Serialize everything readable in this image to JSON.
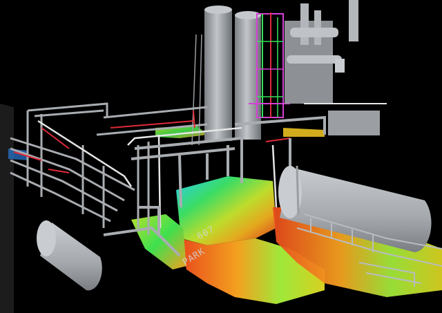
{
  "viewport": {
    "background": "#000000",
    "labels": {
      "unit_number": "607",
      "unit_number_small": "607",
      "area_name": "PARK"
    },
    "colors": {
      "steel": "#a9adb1",
      "steel_dark": "#6d7276",
      "pipe_red": "#e02a3a",
      "pipe_green": "#37e05a",
      "pipe_magenta": "#d63fd6",
      "pipe_white": "#e6e6e6"
    }
  }
}
